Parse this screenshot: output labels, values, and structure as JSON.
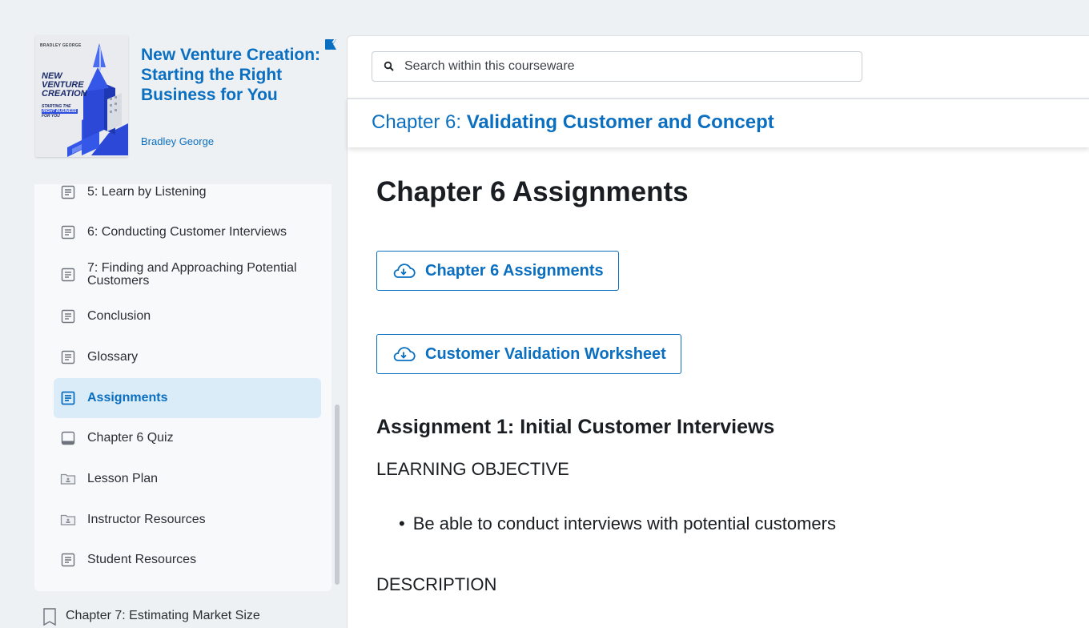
{
  "book": {
    "cover": {
      "author": "BRADLEY GEORGE",
      "title": "NEW VENTURE CREATION",
      "subtitle_prefix": "STARTING THE",
      "subtitle_highlight": "RIGHT BUSINESS",
      "subtitle_suffix": "FOR YOU"
    },
    "title": "New Venture Creation: Starting the Right Business for You",
    "author": "Bradley George"
  },
  "toc": {
    "items": [
      {
        "label": "5: Learn by Listening",
        "icon": "page-icon"
      },
      {
        "label": "6: Conducting Customer Interviews",
        "icon": "page-icon"
      },
      {
        "label": "7: Finding and Approaching Potential Customers",
        "icon": "page-icon"
      },
      {
        "label": "Conclusion",
        "icon": "page-icon"
      },
      {
        "label": "Glossary",
        "icon": "page-icon"
      },
      {
        "label": "Assignments",
        "icon": "page-icon",
        "active": true
      },
      {
        "label": "Chapter 6 Quiz",
        "icon": "quiz-icon"
      },
      {
        "label": "Lesson Plan",
        "icon": "folder-icon"
      },
      {
        "label": "Instructor Resources",
        "icon": "folder-icon"
      },
      {
        "label": "Student Resources",
        "icon": "page-icon"
      }
    ],
    "next_chapter": "Chapter 7: Estimating Market Size"
  },
  "search": {
    "placeholder": "Search within this courseware"
  },
  "chapter_bar": {
    "prefix": "Chapter 6: ",
    "name": "Validating Customer and Concept"
  },
  "content": {
    "title": "Chapter 6 Assignments",
    "downloads": [
      "Chapter 6 Assignments",
      "Customer Validation Worksheet"
    ],
    "assignment_heading": "Assignment 1: Initial Customer Interviews",
    "objective_label": "LEARNING OBJECTIVE",
    "objectives": [
      "Be able to conduct interviews with potential customers"
    ],
    "description_label": "DESCRIPTION"
  },
  "colors": {
    "accent": "#0a6fc0",
    "active_bg": "#dbecf9",
    "sidebar_bg": "#eef1f4",
    "panel_bg": "#f8f9fb"
  }
}
